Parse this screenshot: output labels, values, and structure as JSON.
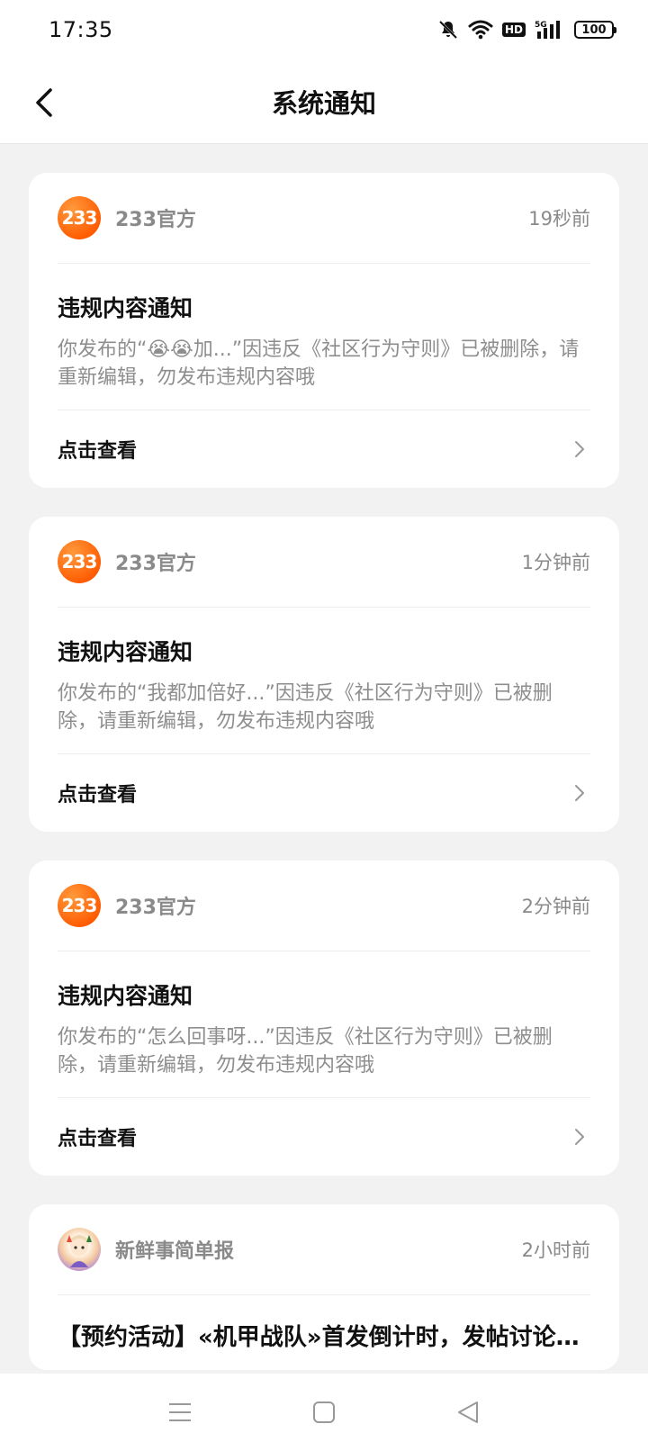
{
  "status_bar": {
    "time": "17:35",
    "network": "5G",
    "hd": "HD",
    "battery": "100",
    "icons": [
      "mute-bell-icon",
      "wifi-icon",
      "hd-icon",
      "signal-icon",
      "battery-icon"
    ]
  },
  "header": {
    "title": "系统通知",
    "back_icon": "chevron-left-icon"
  },
  "notifications": [
    {
      "sender": "233官方",
      "avatar_text": "233",
      "time": "19秒前",
      "title": "违规内容通知",
      "text": "你发布的“😭😭加...”因违反《社区行为守则》已被删除，请重新编辑，勿发布违规内容哦",
      "action": "点击查看"
    },
    {
      "sender": "233官方",
      "avatar_text": "233",
      "time": "1分钟前",
      "title": "违规内容通知",
      "text": "你发布的“我都加倍好...”因违反《社区行为守则》已被删除，请重新编辑，勿发布违规内容哦",
      "action": "点击查看"
    },
    {
      "sender": "233官方",
      "avatar_text": "233",
      "time": "2分钟前",
      "title": "违规内容通知",
      "text": "你发布的“怎么回事呀...”因违反《社区行为守则》已被删除，请重新编辑，勿发布违规内容哦",
      "action": "点击查看"
    },
    {
      "sender": "新鲜事简单报",
      "time": "2小时前",
      "title": "【预约活动】«机甲战队»首发倒计时，发帖讨论赢好礼"
    }
  ],
  "colors": {
    "brand_orange": "#ff6a00",
    "background": "#f2f2f2",
    "muted_text": "#8e8e8e"
  },
  "nav_bar": {
    "icons": [
      "menu-icon",
      "home-square-icon",
      "back-triangle-icon"
    ]
  }
}
